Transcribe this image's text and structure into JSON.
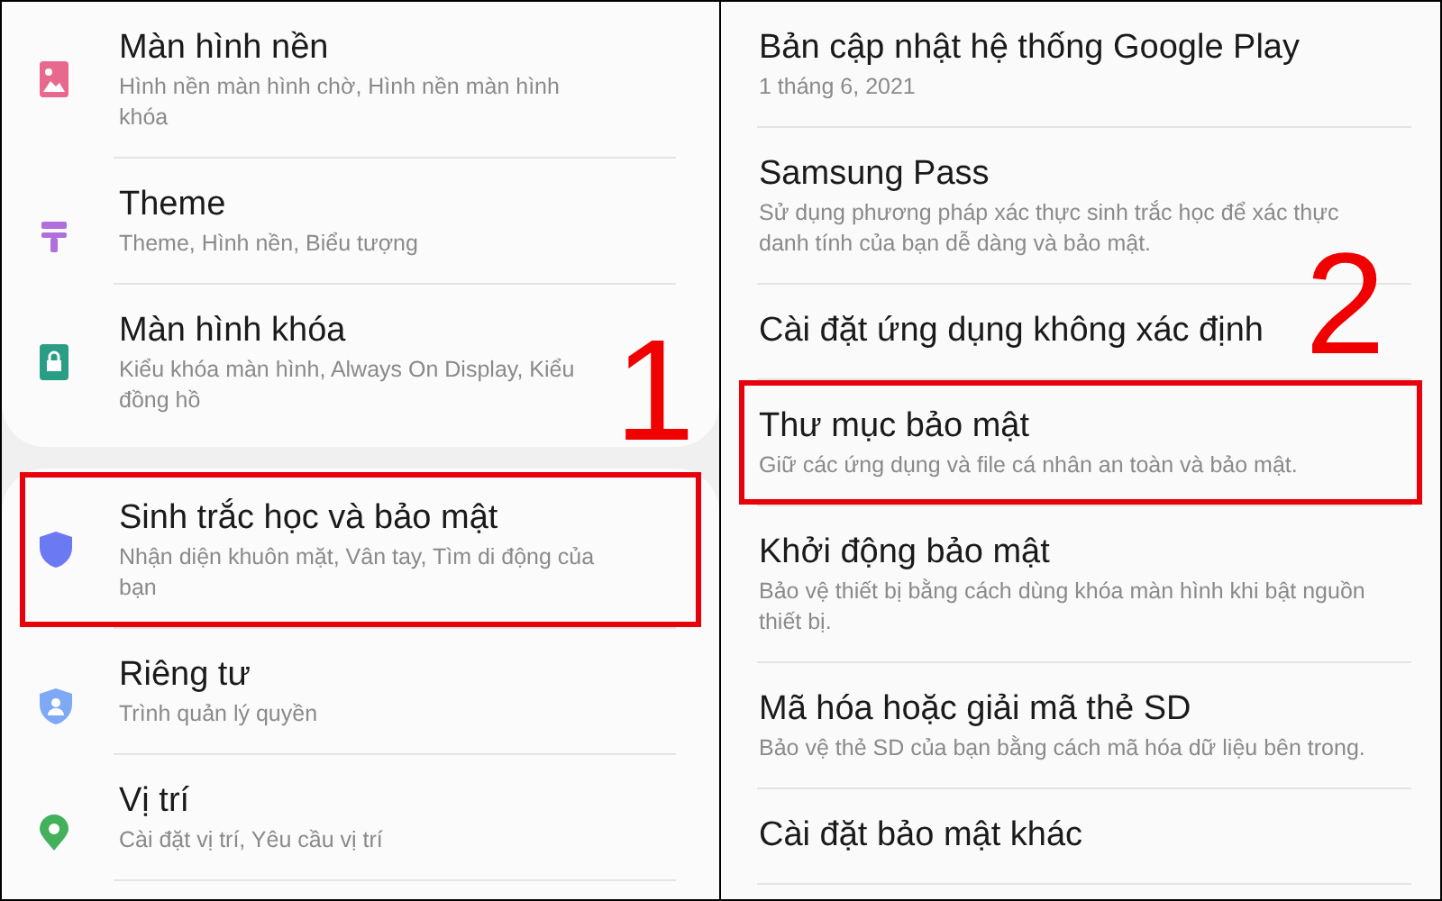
{
  "panels": [
    {
      "step_label": "1",
      "groups": [
        {
          "items": [
            {
              "title": "Màn hình nền",
              "subtitle": "Hình nền màn hình chờ, Hình nền màn hình khóa",
              "highlighted": false
            },
            {
              "title": "Theme",
              "subtitle": "Theme, Hình nền, Biểu tượng",
              "highlighted": false
            },
            {
              "title": "Màn hình khóa",
              "subtitle": "Kiểu khóa màn hình, Always On Display, Kiểu đồng hồ",
              "highlighted": false
            }
          ]
        },
        {
          "items": [
            {
              "title": "Sinh trắc học và bảo mật",
              "subtitle": "Nhận diện khuôn mặt, Vân tay, Tìm di động của bạn",
              "highlighted": true
            },
            {
              "title": "Riêng tư",
              "subtitle": "Trình quản lý quyền",
              "highlighted": false
            },
            {
              "title": "Vị trí",
              "subtitle": "Cài đặt vị trí, Yêu cầu vị trí",
              "highlighted": false
            }
          ]
        }
      ]
    },
    {
      "step_label": "2",
      "groups": [
        {
          "items": [
            {
              "title": "Bản cập nhật hệ thống Google Play",
              "subtitle": "1 tháng 6, 2021",
              "highlighted": false
            },
            {
              "title": "Samsung Pass",
              "subtitle": "Sử dụng phương pháp xác thực sinh trắc học để xác thực danh tính của bạn dễ dàng và bảo mật.",
              "highlighted": false
            },
            {
              "title": "Cài đặt ứng dụng không xác định",
              "highlighted": false
            },
            {
              "title": "Thư mục bảo mật",
              "subtitle": "Giữ các ứng dụng và file cá nhân an toàn và bảo mật.",
              "highlighted": true
            },
            {
              "title": "Khởi động bảo mật",
              "subtitle": "Bảo vệ thiết bị bằng cách dùng khóa màn hình khi bật nguồn thiết bị.",
              "highlighted": false
            },
            {
              "title": "Mã hóa hoặc giải mã thẻ SD",
              "subtitle": "Bảo vệ thẻ SD của bạn bằng cách mã hóa dữ liệu bên trong.",
              "highlighted": false
            },
            {
              "title": "Cài đặt bảo mật khác",
              "highlighted": false
            }
          ]
        }
      ]
    }
  ]
}
